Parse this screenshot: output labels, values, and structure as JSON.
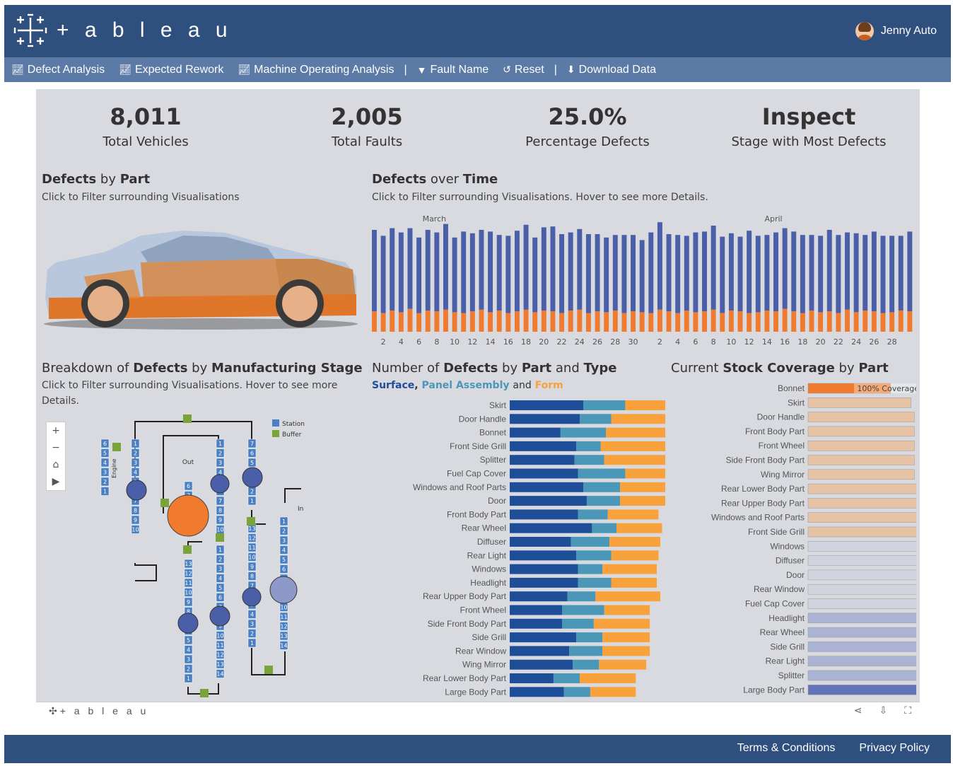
{
  "header": {
    "logo_text": "+ a b l e a u",
    "user_name": "Jenny Auto"
  },
  "nav": [
    {
      "label": "Defect Analysis",
      "icon": "line-chart-icon"
    },
    {
      "label": "Expected Rework",
      "icon": "line-chart-icon"
    },
    {
      "label": "Machine Operating Analysis",
      "icon": "line-chart-icon"
    },
    {
      "label": "Fault Name",
      "icon": "filter-icon"
    },
    {
      "label": "Reset",
      "icon": "reset-icon"
    },
    {
      "label": "Download Data",
      "icon": "download-icon"
    }
  ],
  "kpis": [
    {
      "value": "8,011",
      "label": "Total Vehicles"
    },
    {
      "value": "2,005",
      "label": "Total Faults"
    },
    {
      "value": "25.0%",
      "label": "Percentage Defects"
    },
    {
      "value": "Inspect",
      "label": "Stage with Most Defects"
    }
  ],
  "sections": {
    "part": {
      "t1": "Defects",
      "t2": " by ",
      "t3": "Part",
      "sub": "Click to Filter surrounding Visualisations"
    },
    "time": {
      "t1": "Defects",
      "t2": " over ",
      "t3": "Time",
      "sub": "Click to Filter surrounding Visualisations. Hover to see more Details."
    },
    "stage": {
      "t0": "Breakdown of ",
      "t1": "Defects",
      "t2": " by ",
      "t3": "Manufacturing Stage",
      "sub": "Click to Filter surrounding Visualisations. Hover to see more Details."
    },
    "type": {
      "t0": "Number of ",
      "t1": "Defects",
      "t2": " by ",
      "t3": "Part",
      "t4": " and ",
      "t5": "Type"
    },
    "stock": {
      "t0": "Current ",
      "t1": "Stock Coverage",
      "t2": " by ",
      "t3": "Part"
    }
  },
  "legend": {
    "surface": "Surface",
    "comma": ",",
    "panel": "Panel Assembly",
    "and": "and",
    "form": "Form"
  },
  "colors": {
    "surface": "#1f4e99",
    "panel": "#4a97b8",
    "form": "#f9a13a",
    "time_top": "#4a5fa8",
    "time_bottom": "#f07b2f"
  },
  "map": {
    "legend_station": "Station",
    "legend_buffer": "Buffer",
    "label_out": "Out",
    "label_in": "In",
    "label_engine": "Engine",
    "zoom_in": "+",
    "zoom_out": "−",
    "home": "⌂",
    "play": "▶"
  },
  "stock_annotation": "100% Coverage",
  "footer": {
    "logo_text": "+ a b l e a u",
    "terms": "Terms & Conditions",
    "privacy": "Privacy Policy"
  },
  "chart_data": [
    {
      "type": "bar",
      "title": "Defects over Time",
      "month_labels": [
        "March",
        "April"
      ],
      "x": [
        "1",
        "2",
        "3",
        "4",
        "5",
        "6",
        "7",
        "8",
        "9",
        "10",
        "11",
        "12",
        "13",
        "14",
        "15",
        "16",
        "17",
        "18",
        "19",
        "20",
        "21",
        "22",
        "23",
        "24",
        "25",
        "26",
        "27",
        "28",
        "29",
        "30",
        "31",
        "1",
        "2",
        "3",
        "4",
        "5",
        "6",
        "7",
        "8",
        "9",
        "10",
        "11",
        "12",
        "13",
        "14",
        "15",
        "16",
        "17",
        "18",
        "19",
        "20",
        "21",
        "22",
        "23",
        "24",
        "25",
        "26",
        "27",
        "28",
        "29",
        "30"
      ],
      "tick_labels": [
        "2",
        "4",
        "6",
        "8",
        "10",
        "12",
        "14",
        "16",
        "18",
        "20",
        "22",
        "24",
        "26",
        "28",
        "30",
        "2",
        "4",
        "6",
        "8",
        "10",
        "12",
        "14",
        "16",
        "18",
        "20",
        "22",
        "24",
        "26",
        "28"
      ],
      "series": [
        {
          "values": [
            96,
            91,
            97,
            94,
            95,
            89,
            95,
            93,
            101,
            88,
            96,
            92,
            94,
            95,
            89,
            91,
            95,
            100,
            88,
            98,
            100,
            93,
            92,
            95,
            93,
            91,
            88,
            89,
            92,
            90,
            85,
            95,
            103,
            91,
            92,
            88,
            94,
            94,
            99,
            90,
            91,
            88,
            97,
            90,
            89,
            93,
            95,
            94,
            92,
            89,
            90,
            96,
            92,
            91,
            93,
            89,
            94,
            91,
            90,
            88,
            94
          ]
        },
        {
          "values": [
            24,
            22,
            25,
            23,
            27,
            22,
            25,
            24,
            26,
            23,
            22,
            24,
            26,
            23,
            25,
            22,
            24,
            26,
            23,
            25,
            24,
            22,
            25,
            26,
            22,
            24,
            23,
            25,
            22,
            24,
            23,
            22,
            26,
            24,
            22,
            25,
            23,
            24,
            26,
            22,
            25,
            24,
            22,
            23,
            25,
            24,
            27,
            24,
            22,
            25,
            23,
            24,
            22,
            26,
            23,
            25,
            24,
            22,
            23,
            25,
            24
          ]
        }
      ],
      "ylim": [
        0,
        125
      ]
    },
    {
      "type": "bar",
      "title": "Number of Defects by Part and Type",
      "categories": [
        "Skirt",
        "Door Handle",
        "Bonnet",
        "Front Side Grill",
        "Splitter",
        "Fuel Cap Cover",
        "Windows and Roof Parts",
        "Door",
        "Front Body Part",
        "Rear Wheel",
        "Diffuser",
        "Rear Light",
        "Windows",
        "Headlight",
        "Rear Upper Body Part",
        "Front Wheel",
        "Side Front Body Part",
        "Side Grill",
        "Rear Window",
        "Wing Mirror",
        "Rear Lower Body Part",
        "Large Body Part"
      ],
      "series": [
        {
          "name": "Surface",
          "values": [
            42,
            40,
            29,
            38,
            37,
            39,
            42,
            44,
            39,
            47,
            35,
            38,
            39,
            39,
            33,
            30,
            30,
            38,
            34,
            36,
            25,
            31
          ]
        },
        {
          "name": "Panel Assembly",
          "values": [
            24,
            18,
            26,
            14,
            17,
            27,
            21,
            19,
            17,
            14,
            22,
            20,
            14,
            19,
            16,
            24,
            18,
            15,
            19,
            15,
            15,
            15
          ]
        },
        {
          "name": "Form",
          "values": [
            35,
            38,
            40,
            42,
            39,
            25,
            27,
            26,
            29,
            26,
            29,
            27,
            31,
            26,
            37,
            26,
            32,
            27,
            27,
            27,
            32,
            26
          ]
        }
      ],
      "xlim": [
        0,
        105
      ]
    },
    {
      "type": "bar",
      "title": "Current Stock Coverage by Part",
      "categories": [
        "Bonnet",
        "Skirt",
        "Door Handle",
        "Front Body Part",
        "Front Wheel",
        "Side Front Body Part",
        "Wing Mirror",
        "Rear Lower Body Part",
        "Rear Upper Body Part",
        "Windows and Roof Parts",
        "Front Side Grill",
        "Windows",
        "Diffuser",
        "Door",
        "Rear Window",
        "Fuel Cap Cover",
        "Headlight",
        "Rear Wheel",
        "Side Grill",
        "Rear Light",
        "Splitter",
        "Large Body Part"
      ],
      "values": [
        73,
        91,
        94,
        94,
        94,
        94,
        94,
        96,
        96,
        96,
        98,
        98,
        99,
        99,
        99,
        101,
        101,
        103,
        106,
        108,
        108,
        122
      ],
      "reference_line": 100,
      "xlim": [
        0,
        125
      ]
    }
  ]
}
